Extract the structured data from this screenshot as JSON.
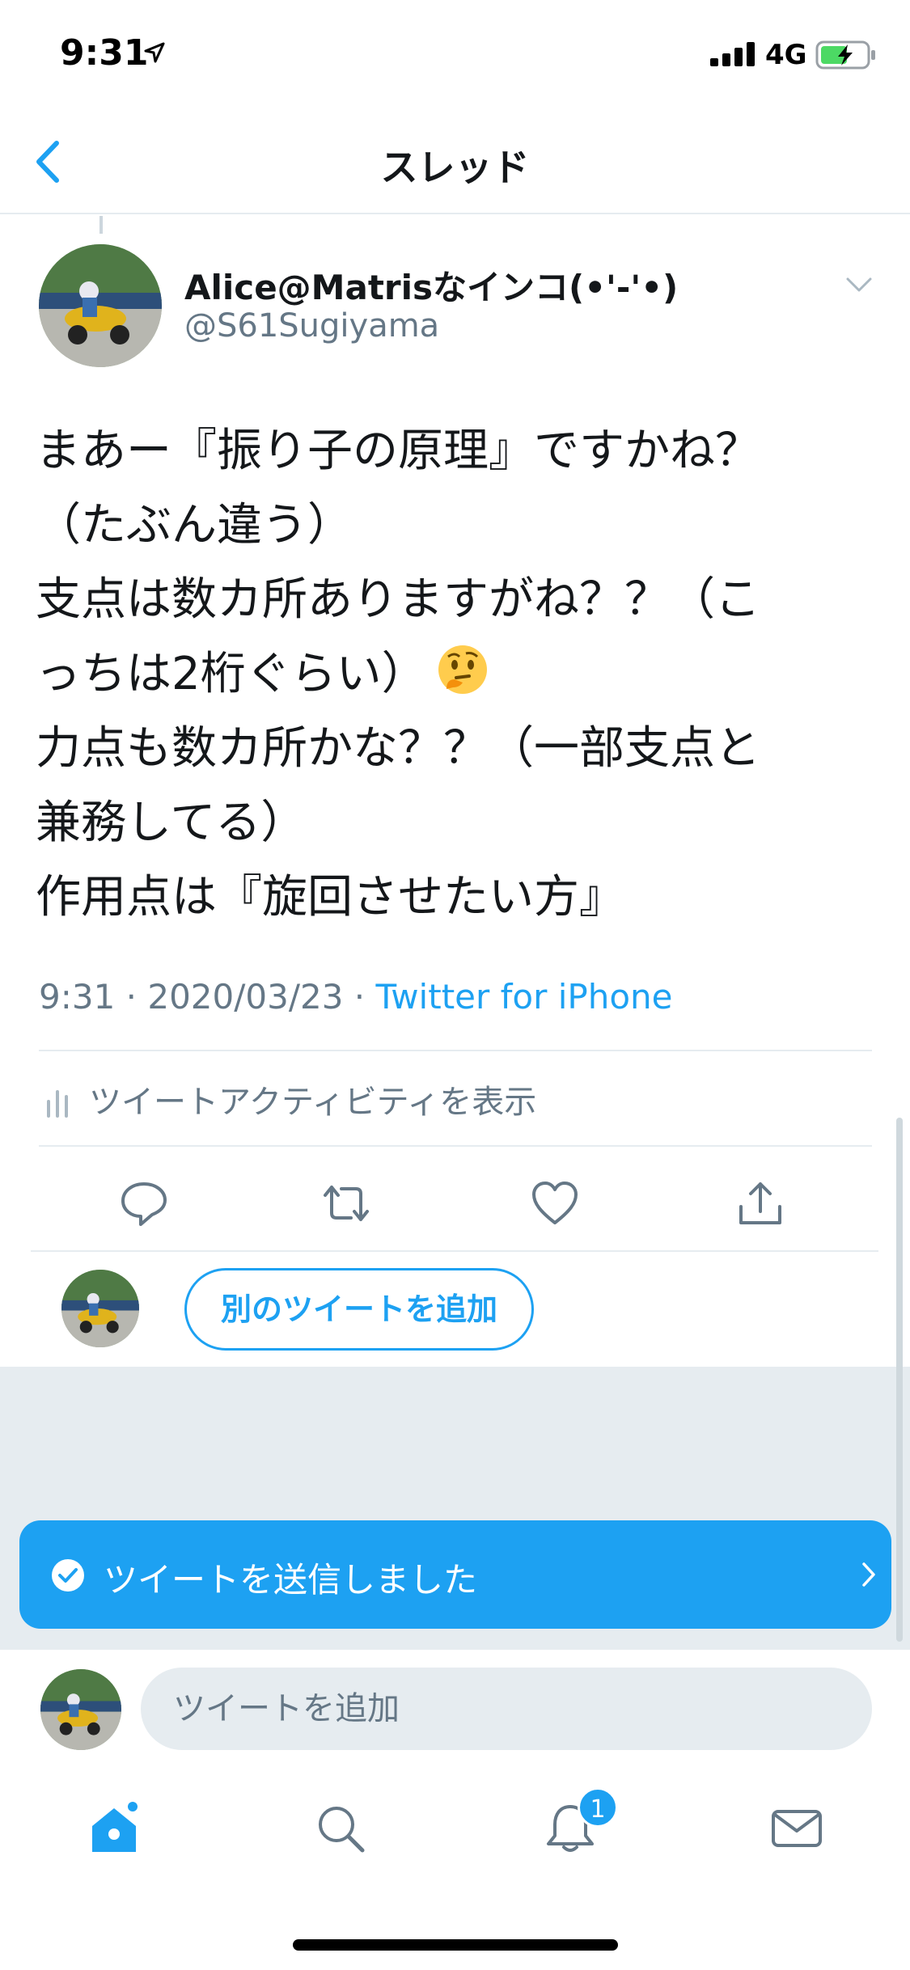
{
  "status_bar": {
    "time": "9:31",
    "network": "4G",
    "icons": [
      "location-arrow-icon",
      "signal-bars-icon",
      "battery-charging-icon"
    ]
  },
  "nav": {
    "title": "スレッド",
    "back_icon": "chevron-left-icon"
  },
  "tweet": {
    "author_name": "Alice@Matrisなインコ(•'-'•)",
    "author_handle": "@S61Sugiyama",
    "text_lines": [
      "まあー『振り子の原理』ですかね？",
      "（たぶん違う）",
      "支点は数カ所ありますがね？？（こ",
      "っちは2桁ぐらい）",
      "力点も数カ所かな？？（一部支点と",
      "兼務してる）",
      "作用点は『旋回させたい方』"
    ],
    "emoji": "thinking-face-emoji",
    "timestamp": "9:31 · 2020/03/23 · ",
    "source": "Twitter for iPhone",
    "activity_label": "ツイートアクティビティを表示"
  },
  "actions": [
    "reply-icon",
    "retweet-icon",
    "like-icon",
    "share-icon"
  ],
  "reply": {
    "add_tweet_label": "別のツイートを追加"
  },
  "toast": {
    "label": "ツイートを送信しました"
  },
  "compose": {
    "placeholder": "ツイートを追加"
  },
  "tab_bar": {
    "tabs": [
      "home-icon",
      "search-icon",
      "notifications-icon",
      "messages-icon"
    ],
    "notification_count": "1"
  },
  "colors": {
    "accent": "#1da1f2",
    "secondary_text": "#657786",
    "divider": "#e6ecf0"
  }
}
